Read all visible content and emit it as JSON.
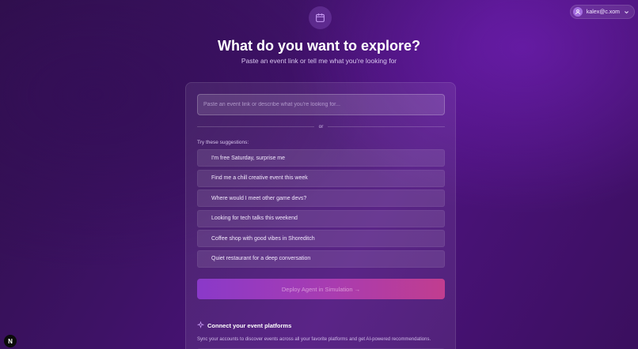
{
  "user": {
    "email": "kalex@c.xom",
    "avatar_icon": "user-icon",
    "menu_icon": "chevron-down-icon"
  },
  "header": {
    "icon": "calendar-icon",
    "title": "What do you want to explore?",
    "subtitle": "Paste an event link or tell me what you're looking for"
  },
  "search": {
    "placeholder": "Paste an event link or describe what you're looking for...",
    "value": ""
  },
  "divider_text": "or",
  "suggestions": {
    "heading": "Try these suggestions:",
    "items": [
      "I'm free Saturday, surprise me",
      "Find me a chill creative event this week",
      "Where would I meet other game devs?",
      "Looking for tech talks this weekend",
      "Coffee shop with good vibes in Shoreditch",
      "Quiet restaurant for a deep conversation"
    ]
  },
  "deploy_button": "Deploy Agent in Simulation →",
  "connect": {
    "icon": "sparkle-icon",
    "title": "Connect your event platforms",
    "description": "Sync your accounts to discover events across all your favorite platforms and get AI-powered recommendations."
  },
  "badge": "N",
  "colors": {
    "background": "#3e1266",
    "accent_start": "#8a39c9",
    "accent_end": "#c13d8f"
  }
}
